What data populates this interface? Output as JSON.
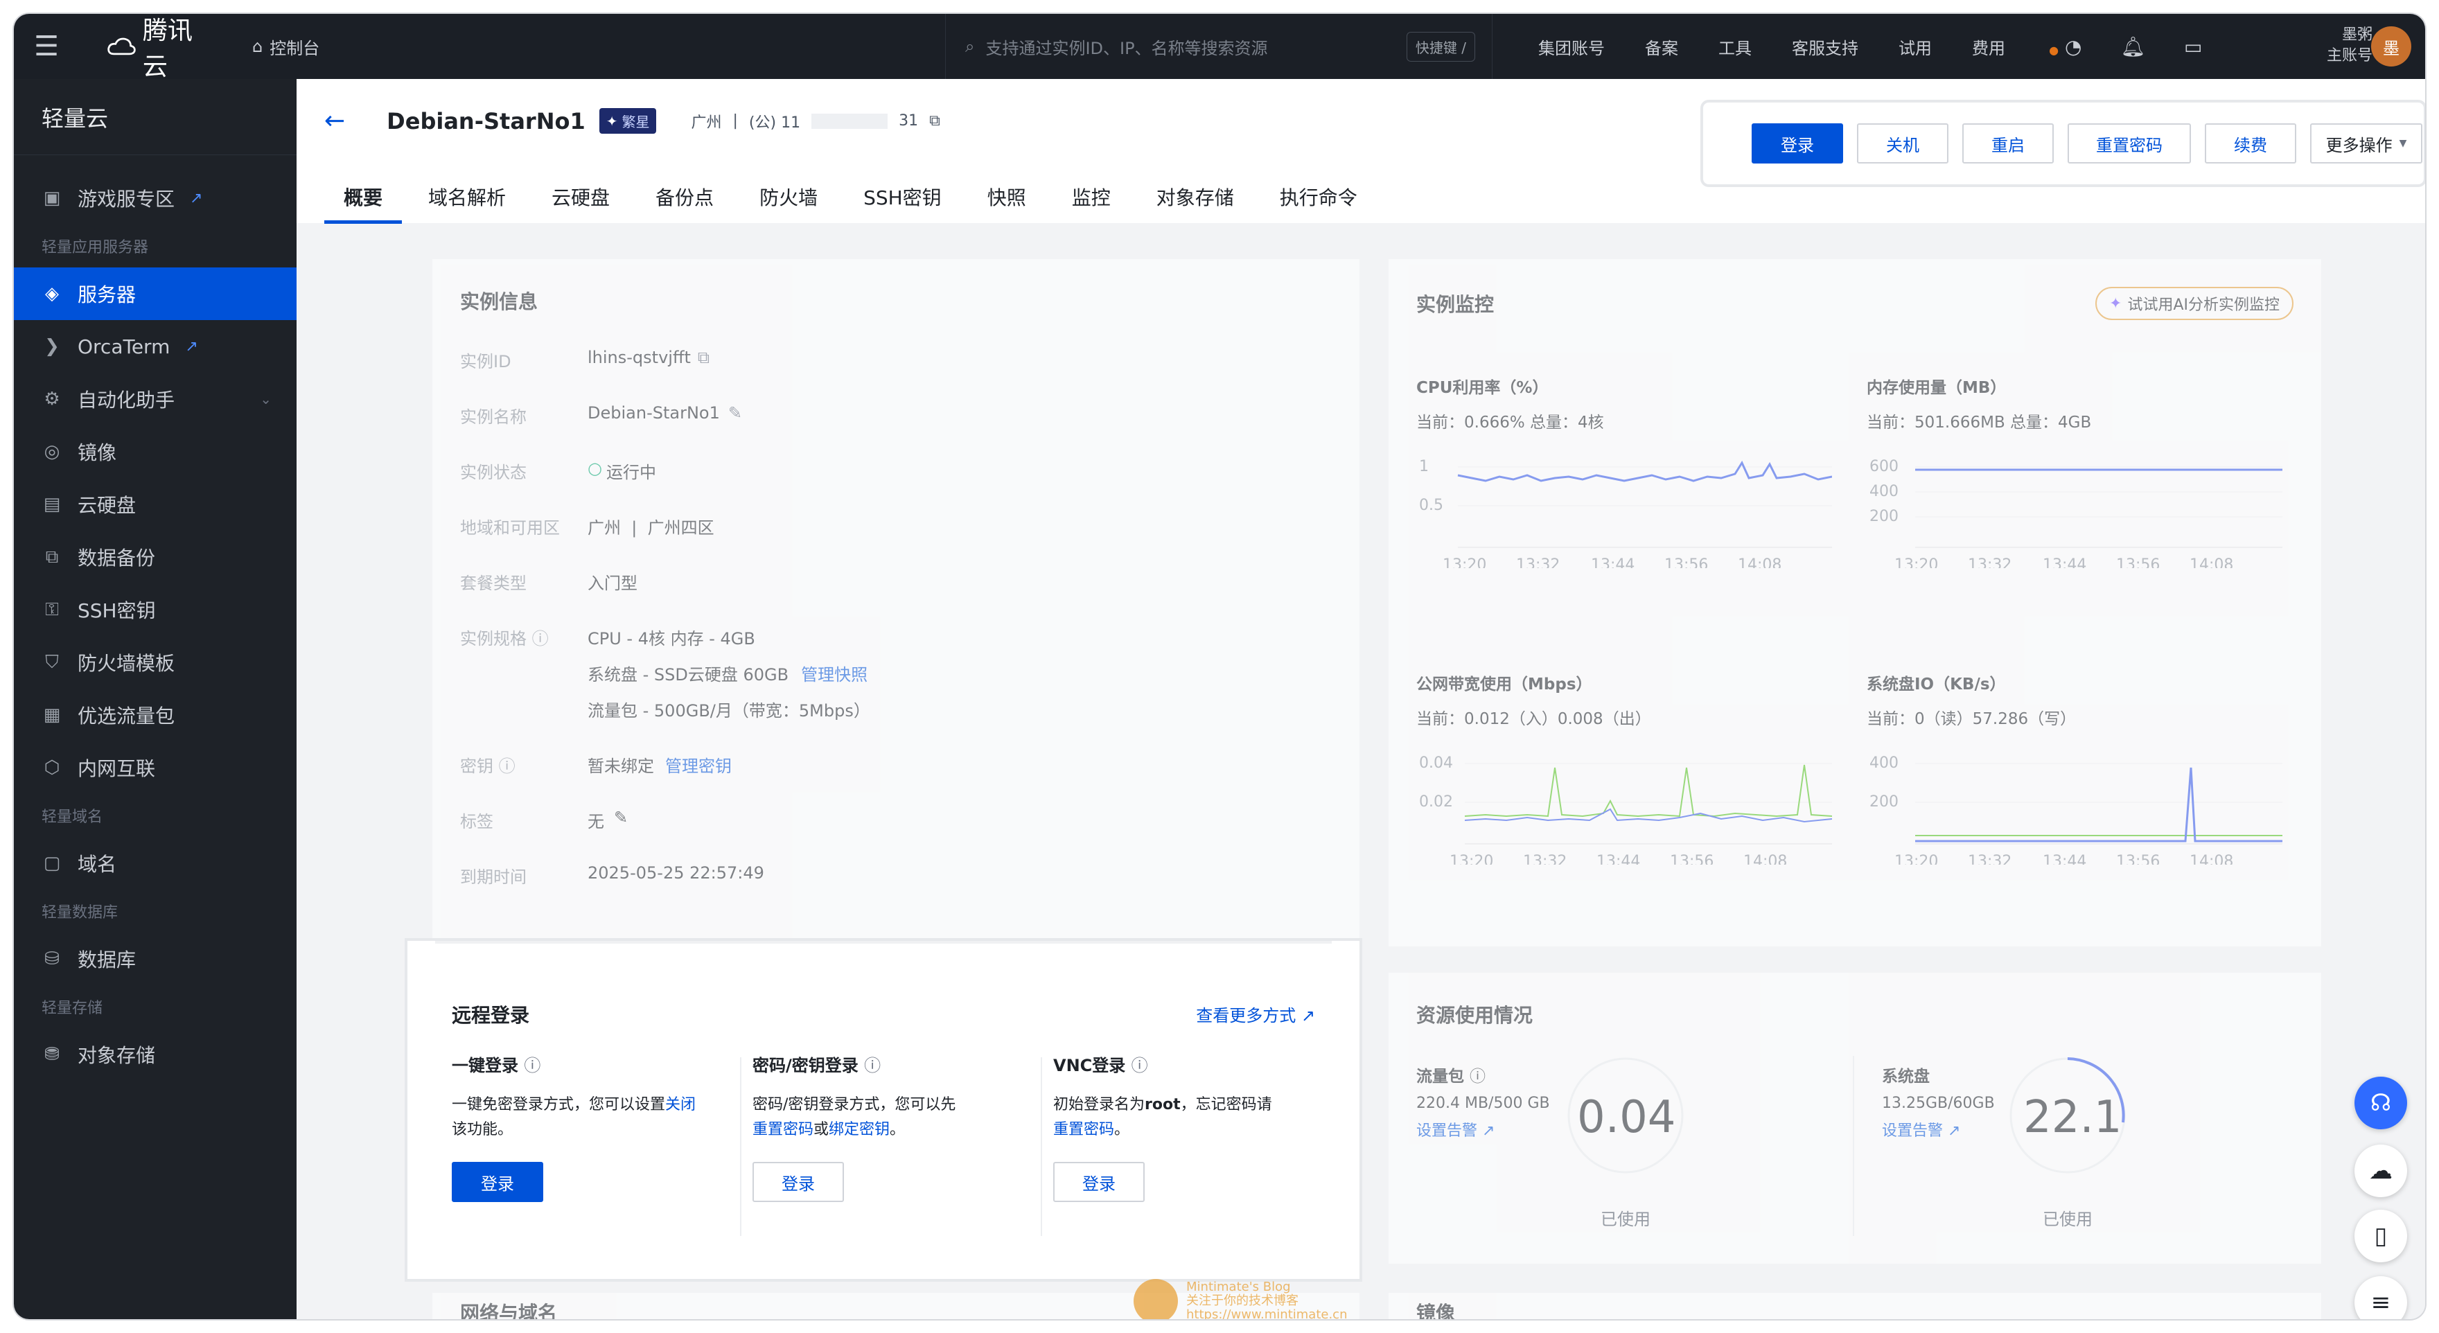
{
  "topbar": {
    "brand": "腾讯云",
    "console": "控制台",
    "search_placeholder": "支持通过实例ID、IP、名称等搜索资源",
    "shortcut": "快捷键 /",
    "links": [
      "集团账号",
      "备案",
      "工具",
      "客服支持",
      "试用",
      "费用"
    ],
    "user_line1": "墨粥",
    "user_line2": "主账号",
    "avatar_text": "墨"
  },
  "sidebar": {
    "title": "轻量云",
    "game_zone": "游戏服专区",
    "group_app": "轻量应用服务器",
    "items_app": [
      "服务器",
      "OrcaTerm",
      "自动化助手",
      "镜像",
      "云硬盘",
      "数据备份",
      "SSH密钥",
      "防火墙模板",
      "优选流量包",
      "内网互联"
    ],
    "group_domain": "轻量域名",
    "domain": "域名",
    "group_db": "轻量数据库",
    "db": "数据库",
    "group_storage": "轻量存储",
    "storage": "对象存储"
  },
  "header": {
    "title": "Debian-StarNo1",
    "badge": "繁星",
    "region": "广州",
    "sep": "|",
    "ip_prefix": "(公) 11",
    "ip_suffix": "31",
    "tabs": [
      "概要",
      "域名解析",
      "云硬盘",
      "备份点",
      "防火墙",
      "SSH密钥",
      "快照",
      "监控",
      "对象存储",
      "执行命令"
    ]
  },
  "actions": {
    "login": "登录",
    "shutdown": "关机",
    "restart": "重启",
    "reset_pwd": "重置密码",
    "renew": "续费",
    "more": "更多操作"
  },
  "instance_info": {
    "title": "实例信息",
    "rows": [
      {
        "label": "实例ID",
        "value": "lhins-qstvjfft"
      },
      {
        "label": "实例名称",
        "value": "Debian-StarNo1"
      },
      {
        "label": "实例状态",
        "value": "运行中"
      },
      {
        "label": "地域和可用区",
        "value": "广州  |  广州四区"
      },
      {
        "label": "套餐类型",
        "value": "入门型"
      },
      {
        "label": "实例规格",
        "value": "CPU - 4核 内存 - 4GB"
      },
      {
        "label": "",
        "value": "系统盘 - SSD云硬盘 60GB"
      },
      {
        "label": "",
        "value": "流量包 - 500GB/月（带宽：5Mbps）"
      },
      {
        "label": "密钥",
        "value": "暂未绑定"
      },
      {
        "label": "标签",
        "value": "无"
      },
      {
        "label": "到期时间",
        "value": "2025-05-25 22:57:49"
      }
    ],
    "manage_snapshot": "管理快照",
    "manage_key": "管理密钥"
  },
  "monitor": {
    "title": "实例监控",
    "ai_button": "试试用AI分析实例监控",
    "cpu": {
      "title": "CPU利用率（%）",
      "current": "当前：0.666% 总量：4核",
      "yticks": [
        "1",
        "0.5"
      ]
    },
    "mem": {
      "title": "内存使用量（MB）",
      "current": "当前：501.666MB 总量：4GB",
      "yticks": [
        "600",
        "400",
        "200"
      ]
    },
    "net": {
      "title": "公网带宽使用（Mbps）",
      "current": "当前：0.012（入）0.008（出）",
      "yticks": [
        "0.04",
        "0.02"
      ]
    },
    "io": {
      "title": "系统盘IO（KB/s）",
      "current": "当前：0（读）57.286（写）",
      "yticks": [
        "400",
        "200"
      ]
    },
    "xticks": [
      "13:20",
      "13:32",
      "13:44",
      "13:56",
      "14:08"
    ]
  },
  "remote_login": {
    "title": "远程登录",
    "more_ways": "查看更多方式",
    "one_click": {
      "title": "一键登录",
      "desc1": "一键免密登录方式，您可以设置",
      "close": "关闭",
      "desc2": "该功能。",
      "btn": "登录"
    },
    "pwd": {
      "title": "密码/密钥登录",
      "desc1": "密码/密钥登录方式，您可以先",
      "reset": "重置密码",
      "or": "或",
      "bind": "绑定密钥",
      "end": "。",
      "btn": "登录"
    },
    "vnc": {
      "title": "VNC登录",
      "desc1a": "初始登录名为",
      "root": "root",
      "desc1b": "，忘记密码请",
      "reset": "重置密码",
      "end": "。",
      "btn": "登录"
    }
  },
  "resource": {
    "title": "资源使用情况",
    "traffic": {
      "label": "流量包",
      "value": "220.4 MB/500 GB",
      "alert": "设置告警",
      "percent": "0.04",
      "used": "已使用"
    },
    "disk": {
      "label": "系统盘",
      "value": "13.25GB/60GB",
      "alert": "设置告警",
      "percent": "22.1",
      "used": "已使用"
    }
  },
  "bottom": {
    "network": "网络与域名",
    "image": "镜像"
  },
  "watermark": {
    "line1": "Mintimate's Blog",
    "line2": "关注于你的技术博客",
    "line3": "https://www.mintimate.cn"
  }
}
